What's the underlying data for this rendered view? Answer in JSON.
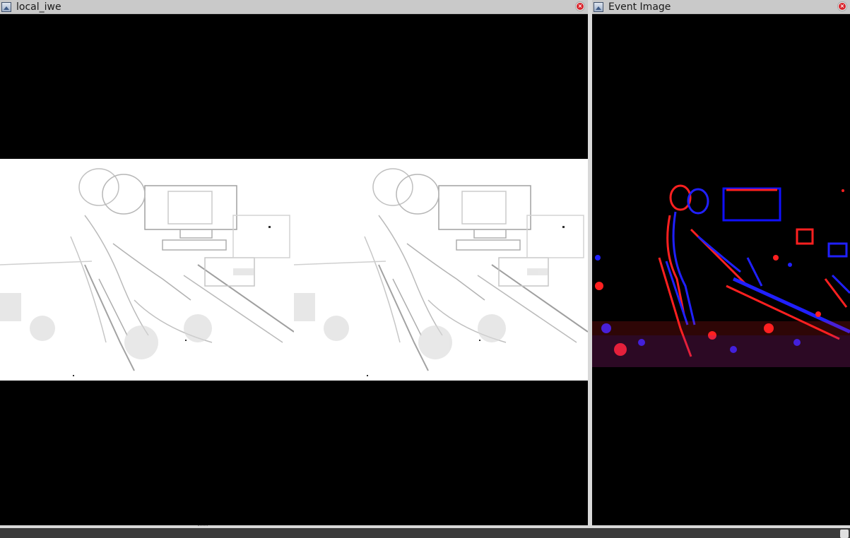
{
  "windows": [
    {
      "title": "local_iwe",
      "icon": "image-window-icon",
      "close_icon": "close-icon"
    },
    {
      "title": "Event Image",
      "icon": "image-window-icon",
      "close_icon": "close-icon"
    }
  ],
  "colors": {
    "titlebar_bg": "#c9c9c9",
    "canvas_bg": "#000000",
    "iwe_bg": "#ffffff",
    "event_positive": "#ff0000",
    "event_negative": "#0000ff",
    "close_red": "#d8232a"
  }
}
